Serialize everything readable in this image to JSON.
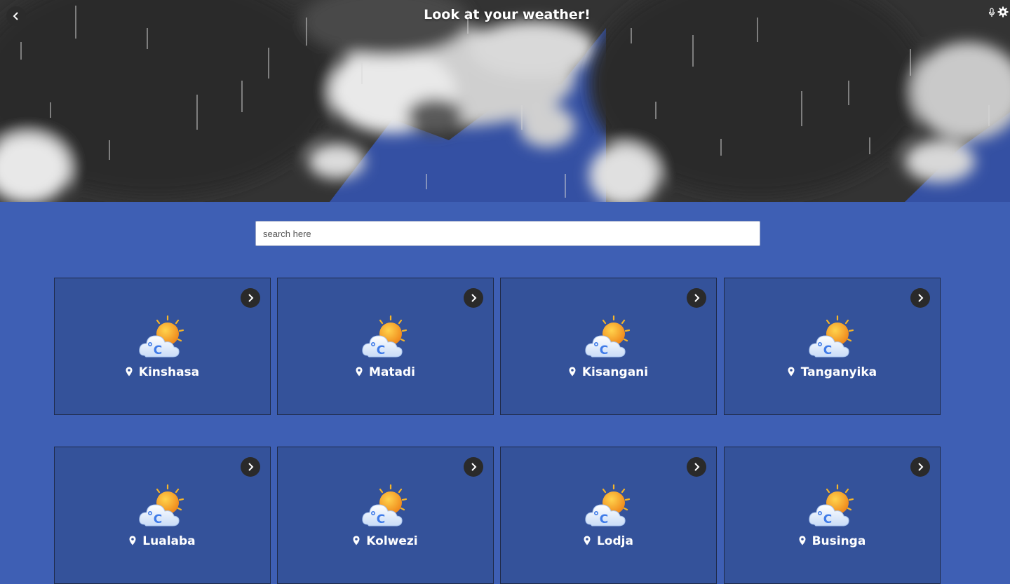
{
  "header": {
    "title": "Look at your weather!",
    "back_icon": "chevron-left-icon",
    "mic_icon": "microphone-icon",
    "settings_icon": "gear-icon"
  },
  "search": {
    "placeholder": "search here",
    "value": ""
  },
  "colors": {
    "page_background": "#3e5fb4",
    "card_background": "#34529a",
    "button_background": "#2a2a2a",
    "sun": "#f5a623",
    "cloud": "#eaf2ff"
  },
  "cities": [
    {
      "name": "Kinshasa",
      "icon": "partly-cloudy-celsius-icon"
    },
    {
      "name": "Matadi",
      "icon": "partly-cloudy-celsius-icon"
    },
    {
      "name": "Kisangani",
      "icon": "partly-cloudy-celsius-icon"
    },
    {
      "name": "Tanganyika",
      "icon": "partly-cloudy-celsius-icon"
    },
    {
      "name": "Lualaba",
      "icon": "partly-cloudy-celsius-icon"
    },
    {
      "name": "Kolwezi",
      "icon": "partly-cloudy-celsius-icon"
    },
    {
      "name": "Lodja",
      "icon": "partly-cloudy-celsius-icon"
    },
    {
      "name": "Businga",
      "icon": "partly-cloudy-celsius-icon"
    }
  ]
}
